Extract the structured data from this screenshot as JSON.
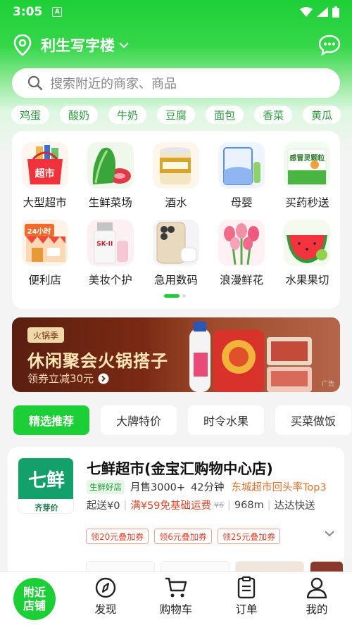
{
  "status_bar": {
    "time": "3:05",
    "notification_letter": "A"
  },
  "location": {
    "name": "利生写字楼"
  },
  "search": {
    "placeholder": "搜索附近的商家、商品"
  },
  "quick_chips": [
    "鸡蛋",
    "酸奶",
    "牛奶",
    "豆腐",
    "面包",
    "香菜",
    "黄瓜"
  ],
  "categories": [
    {
      "label": "大型超市",
      "icon": "supermarket-basket",
      "icon_text": "超市"
    },
    {
      "label": "生鲜菜场",
      "icon": "vegetables-meat"
    },
    {
      "label": "酒水",
      "icon": "beer-bottle"
    },
    {
      "label": "母婴",
      "icon": "milk-powder-can"
    },
    {
      "label": "买药秒送",
      "icon": "medicine-box",
      "icon_text": "感冒灵颗粒"
    },
    {
      "label": "便利店",
      "icon": "convenience-store",
      "icon_text": "24小时"
    },
    {
      "label": "美妆个护",
      "icon": "skincare-bottle",
      "icon_text": "SK-II"
    },
    {
      "label": "急用数码",
      "icon": "phone-earbuds"
    },
    {
      "label": "浪漫鲜花",
      "icon": "tulips"
    },
    {
      "label": "水果果切",
      "icon": "watermelon"
    }
  ],
  "banner": {
    "tag": "火锅季",
    "headline": "休闲聚会火锅搭子",
    "sub": "领券立减30元",
    "ad_label": "广告"
  },
  "feed_tabs": [
    {
      "label": "精选推荐",
      "active": true
    },
    {
      "label": "大牌特价",
      "active": false
    },
    {
      "label": "时令水果",
      "active": false
    },
    {
      "label": "买菜做饭",
      "active": false
    }
  ],
  "store": {
    "logo_text": "七鲜",
    "logo_sub": "齐芽价",
    "name": "七鲜超市(金宝汇购物中心店)",
    "badge": "生鲜好店",
    "monthly_sales": "月售3000+",
    "delivery_time": "42分钟",
    "rank_text": "东城超市回头率Top3",
    "min_order": "起送¥0",
    "free_delivery": "满¥59免基础运费",
    "original_fee": "¥6",
    "distance": "968m",
    "delivery_service": "达达快送",
    "coupons": [
      "领20元叠加券",
      "领6元叠加券",
      "领25元叠加券"
    ]
  },
  "bottom_nav": [
    {
      "label": "附近店铺",
      "line1": "附近",
      "line2": "店铺",
      "icon": "home-badge"
    },
    {
      "label": "发现",
      "icon": "compass-icon"
    },
    {
      "label": "购物车",
      "icon": "cart-icon"
    },
    {
      "label": "订单",
      "icon": "order-icon"
    },
    {
      "label": "我的",
      "icon": "user-icon"
    }
  ],
  "colors": {
    "brand_green": "#1dcf37",
    "promo_red": "#e0442c"
  }
}
